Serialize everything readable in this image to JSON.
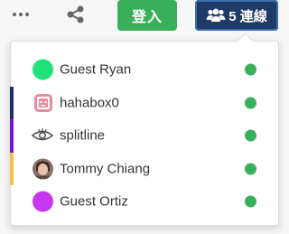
{
  "toolbar": {
    "more_icon": "more-horizontal-icon",
    "share_icon": "share-icon",
    "login_label": "登入",
    "online_count_label": "5 連線",
    "online_icon": "users-icon",
    "login_color": "#3aaf5b",
    "online_color": "#1e3a66"
  },
  "online_users": [
    {
      "name": "Guest Ryan",
      "avatar": "solid-circle",
      "avatar_color": "#22e07a",
      "bar_color": "",
      "status": "online"
    },
    {
      "name": "hahabox0",
      "avatar": "pink-box-face",
      "avatar_color": "#e98a9c",
      "bar_color": "#1f2f66",
      "status": "online"
    },
    {
      "name": "splitline",
      "avatar": "eye-logo",
      "avatar_color": "#555555",
      "bar_color": "#6a1bd6",
      "status": "online"
    },
    {
      "name": "Tommy Chiang",
      "avatar": "photo",
      "avatar_color": "#b89a8c",
      "bar_color": "#f2c24e",
      "status": "online"
    },
    {
      "name": "Guest Ortiz",
      "avatar": "solid-circle",
      "avatar_color": "#c637f2",
      "bar_color": "",
      "status": "online"
    }
  ],
  "status_color": "#3aaf5b"
}
